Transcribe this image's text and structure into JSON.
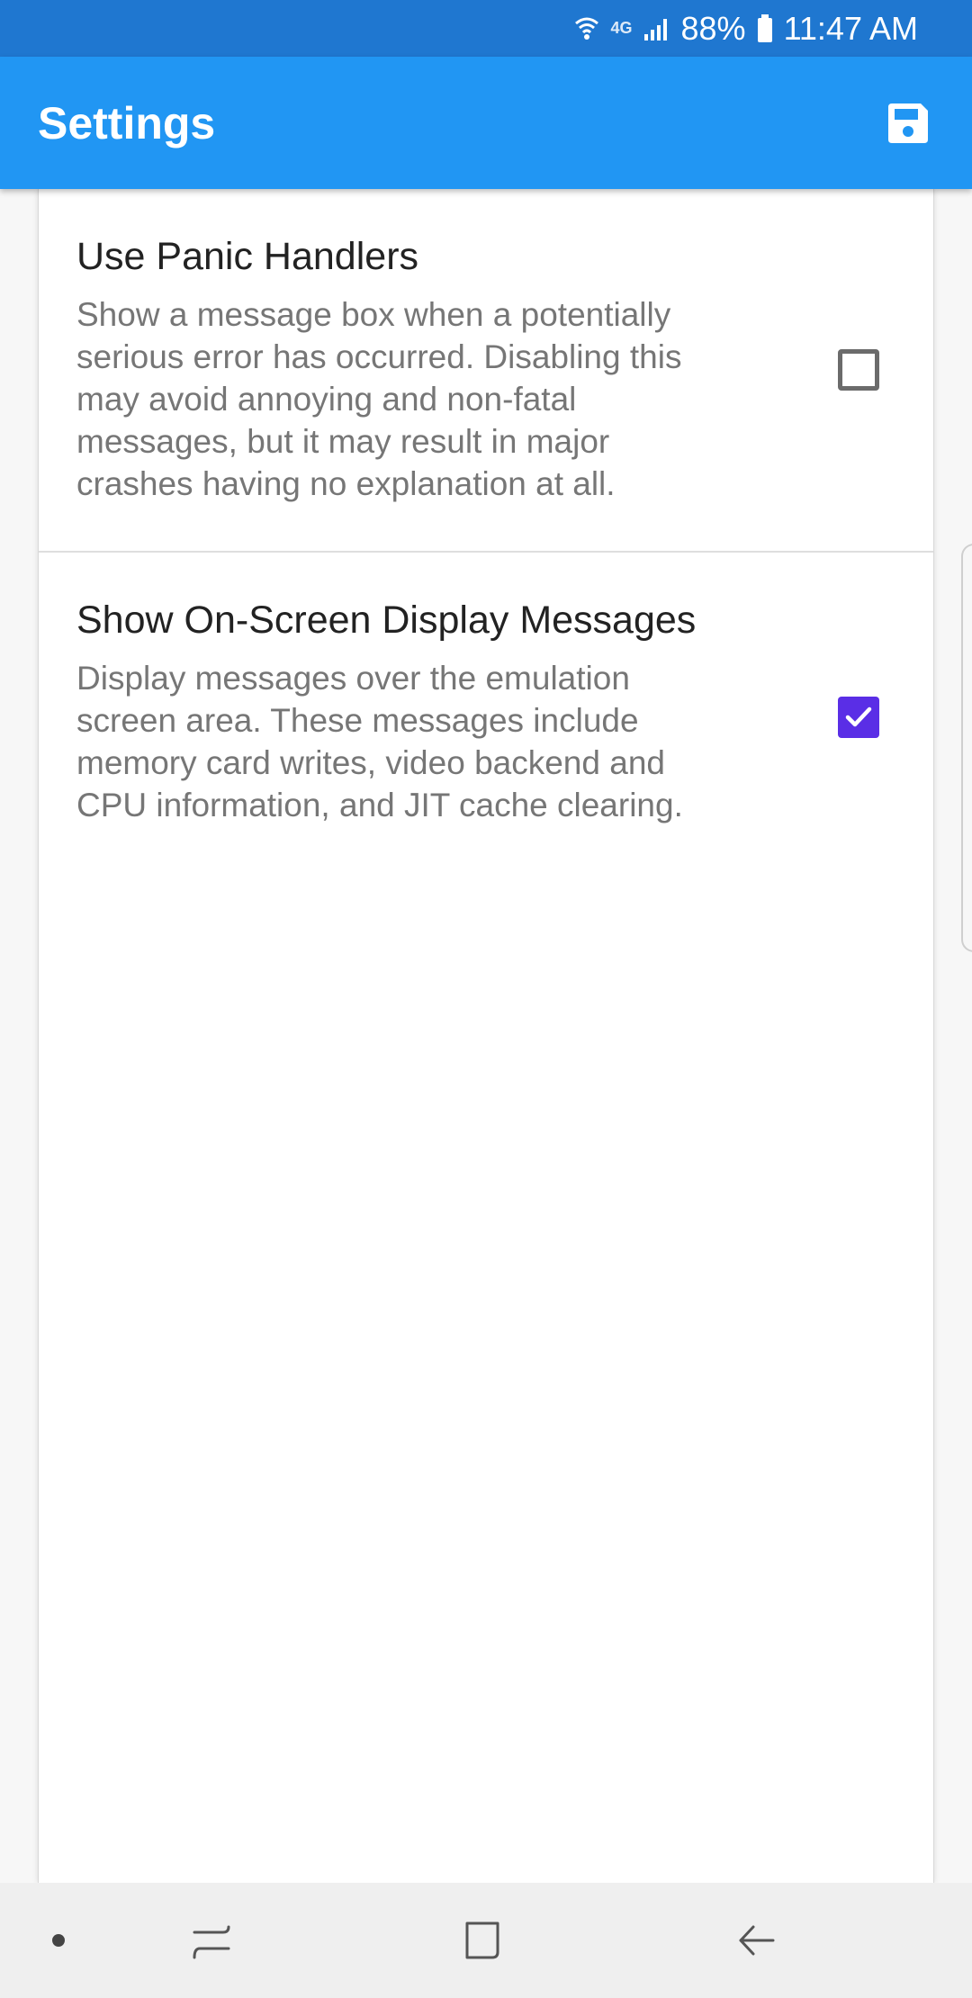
{
  "status_bar": {
    "network": "4G",
    "battery": "88%",
    "time": "11:47 AM",
    "icons": [
      "wifi-icon",
      "network-4g-icon",
      "signal-icon",
      "battery-icon"
    ]
  },
  "app_bar": {
    "title": "Settings",
    "save_icon": "save-icon"
  },
  "settings": [
    {
      "title": "Use Panic Handlers",
      "description": "Show a message box when a potentially serious error has occurred. Disabling this may avoid annoying and non-fatal messages, but it may result in major crashes having no explanation at all.",
      "checked": false
    },
    {
      "title": "Show On-Screen Display Messages",
      "description": "Display messages over the emulation screen area. These messages include memory card writes, video backend and CPU information, and JIT cache clearing.",
      "checked": true
    }
  ],
  "nav_bar": {
    "icons": [
      "dot-icon",
      "recents-icon",
      "home-icon",
      "back-icon"
    ]
  },
  "colors": {
    "status_bar": "#1f77d0",
    "app_bar": "#2196f3",
    "checkbox_accent": "#5a2ee6"
  }
}
